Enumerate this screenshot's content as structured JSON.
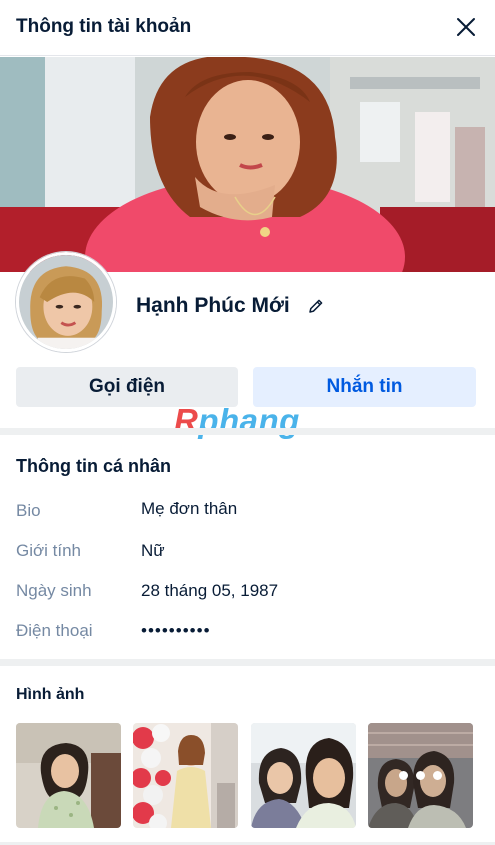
{
  "header": {
    "title": "Thông tin tài khoản"
  },
  "profile": {
    "name": "Hạnh Phúc Mới"
  },
  "actions": {
    "call_label": "Gọi điện",
    "message_label": "Nhắn tin"
  },
  "watermark": {
    "r": "R",
    "rest": "phang"
  },
  "personal": {
    "title": "Thông tin cá nhân",
    "rows": [
      {
        "label": "Bio",
        "value": "Mẹ đơn thân"
      },
      {
        "label": "Giới tính",
        "value": "Nữ"
      },
      {
        "label": "Ngày sinh",
        "value": "28 tháng 05, 1987"
      },
      {
        "label": "Điện thoại",
        "value": "••••••••••"
      }
    ]
  },
  "photos": {
    "title": "Hình ảnh"
  },
  "colors": {
    "primary": "#005ae0",
    "text": "#081c36",
    "muted": "#7589a3",
    "secondary_bg": "#eaedf0",
    "primary_bg": "#e5efff"
  }
}
